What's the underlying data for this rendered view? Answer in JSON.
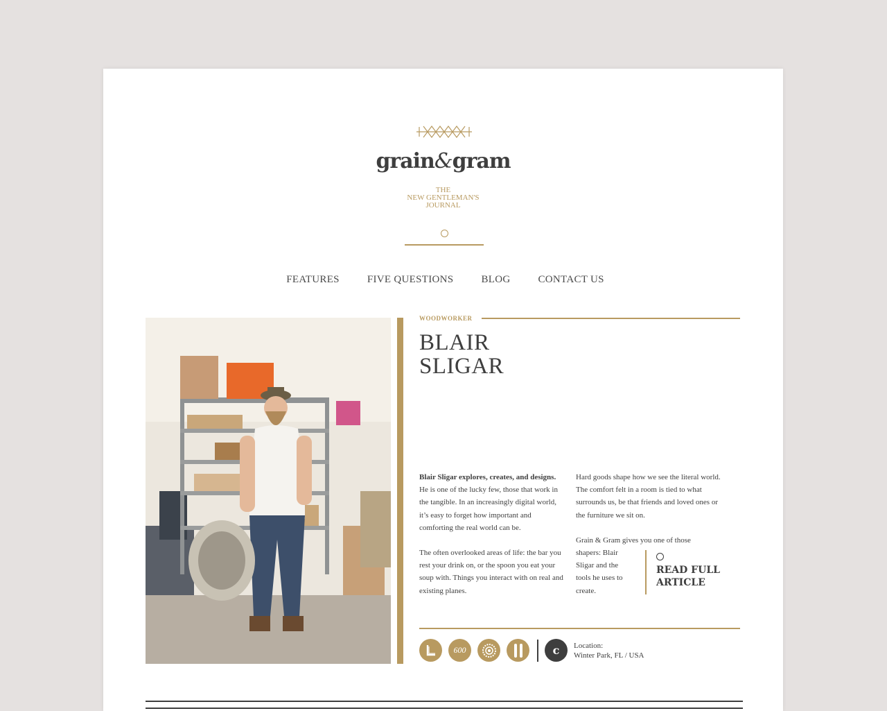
{
  "brand": {
    "name_part1": "grain",
    "name_amp": "&",
    "name_part2": "gram",
    "tagline_line1": "THE",
    "tagline_line2": "NEW GENTLEMAN'S",
    "tagline_line3": "JOURNAL"
  },
  "nav": {
    "items": [
      {
        "label": "FEATURES"
      },
      {
        "label": "FIVE QUESTIONS"
      },
      {
        "label": "BLOG"
      },
      {
        "label": "CONTACT US"
      }
    ]
  },
  "feature": {
    "category": "WOODWORKER",
    "name_line1": "BLAIR",
    "name_line2": "SLIGAR",
    "photo_icon": "portrait-photo",
    "col1": {
      "p1_bold": "Blair Sligar explores, creates, and designs.",
      "p1_rest": " He is one of the lucky few, those that work in the tangible. In an increasingly digital world, it’s easy to forget how important and comforting the real world can be.",
      "p2": "The often overlooked areas of life: the bar you rest your drink on, or the spoon you eat your soup with. Things you interact with on real and existing planes."
    },
    "col2": {
      "p1": "Hard goods shape how we see the literal world. The comfort felt in a room is tied to what surrounds us, be that friends and loved ones or the furniture we sit on.",
      "p2_line1": "Grain & Gram gives you one of those",
      "p2_rest": "shapers: Blair Sligar and the tools he uses to create."
    },
    "read_more": "READ FULL ARTICLE",
    "icons": {
      "icon1": "chair-icon",
      "icon2_label": "600",
      "icon3": "saw-blade-icon",
      "icon4": "utensils-icon",
      "icon5_label": "c"
    },
    "location_label": "Location:",
    "location_value": "Winter Park, FL / USA"
  },
  "colors": {
    "gold": "#b89a60",
    "dark": "#3e3e3e",
    "background": "#e5e1e0"
  }
}
